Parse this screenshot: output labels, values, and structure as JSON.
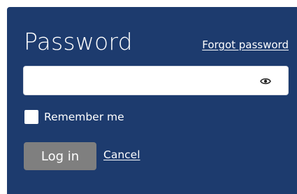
{
  "form": {
    "title": "Password",
    "forgot_link": "Forgot password",
    "password_value": "",
    "remember_label": "Remember me",
    "remember_checked": false,
    "login_label": "Log in",
    "cancel_label": "Cancel"
  },
  "icons": {
    "show_password": "eye-icon"
  },
  "colors": {
    "panel_background": "#1d3b6e",
    "text": "#ffffff",
    "login_button": "#7f7f7f"
  }
}
